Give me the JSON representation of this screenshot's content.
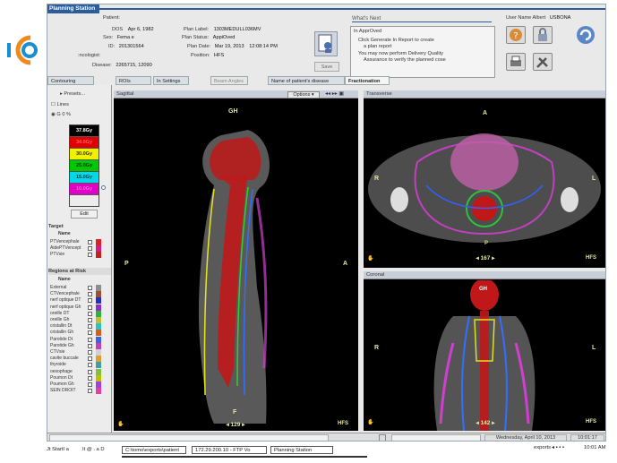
{
  "window": {
    "title": "Planning Station"
  },
  "patient": {
    "heading": "Patient:",
    "dos_label": "DOS",
    "dos": "Apr 6, 1982",
    "sex_label": "Sex:",
    "sex": "Fema e",
    "id_label": "ID:",
    "id": "201301564",
    "oncologist": ":ncologist:",
    "disease_label": "Disease:",
    "disease": "2265715, 12090"
  },
  "plan": {
    "label_label": "Plan Label:",
    "label": "1303MEDULL036MV",
    "status_label": "Plan Status:",
    "status": "AppiOved",
    "date_label": "Plan Date:",
    "date": "Mar 19, 2013",
    "time": "12:08:14 PM",
    "position_label": "Position:",
    "position": "HFS"
  },
  "save_label": "Save",
  "whats_next": {
    "title": "What's Next",
    "lines": [
      "In ApprOved",
      "Click Generate  In Report  to create",
      "a plan report",
      "You may now perform  Delivery Quality",
      "Assurance to verify the planned  cose"
    ]
  },
  "user": {
    "label": "User Name Albert",
    "name": "USBONA"
  },
  "tabs": {
    "contouring": "Contouring",
    "rois": "ROIs",
    "settings": "In Settings",
    "beam_angles": "Beam Angles",
    "name_of_disease": "Name of patient's disease",
    "fractionation": "Fractionation"
  },
  "left": {
    "presets": "Presets...",
    "lines": "Lines",
    "percent": "0  %",
    "doses": [
      "37.8Gy",
      "34.0Gy",
      "30.0Gy",
      "25.0Gy",
      "15.0Gy",
      "10.0Gy"
    ],
    "dose_colors": [
      "#000000",
      "#e00000",
      "#f0f000",
      "#00c800",
      "#00d8e8",
      "#e000c8"
    ],
    "dose_text_colors": [
      "#ffffff",
      "#ff6060",
      "#333300",
      "#003300",
      "#003340",
      "#ff60e0"
    ],
    "edit": "Edit",
    "targets_header": "Target",
    "name_header": "Name",
    "targets": [
      "PTVencephale",
      "AidePTVencept",
      "PTVsie"
    ],
    "target_colors": [
      "#e02020",
      "#d02080",
      "#c02020"
    ],
    "regions_header": "Regions  at Risk",
    "regions": [
      "External",
      "CTVencephale",
      "nerf optique DT",
      "nerf optique Gh",
      "oreille  DT",
      "oreille  Gh",
      "cristallin  Dt",
      "cristallin  Gh",
      "Parotide  Dt",
      "Parotide  Gh",
      "CTVsie",
      "cavite  buccale",
      "thyroide",
      "oesophage",
      "Poumon  Dt",
      "Poumon  Gh",
      "SEIN  DROIT"
    ],
    "region_colors": [
      "#8d8d8d",
      "#a05030",
      "#2030c0",
      "#9030c0",
      "#30b040",
      "#c0c030",
      "#30c0c0",
      "#d06020",
      "#4060e0",
      "#c040c0",
      "#d0d0d0",
      "#e0a030",
      "#40a0a0",
      "#80c040",
      "#c0c000",
      "#a040e0",
      "#e040a0"
    ]
  },
  "views": {
    "sagittal": {
      "title": "Sagittal",
      "top": "GH",
      "bottom": "F",
      "left": "P",
      "right": "A",
      "corner": "HFS",
      "slice": "129",
      "options": "Options"
    },
    "transverse": {
      "title": "Transverse",
      "top": "A",
      "bottom": "P",
      "left": "R",
      "right": "L",
      "corner": "HFS",
      "slice": "167"
    },
    "coronal": {
      "title": "Coronal",
      "top": "GH",
      "left": "R",
      "right": "L",
      "corner": "HFS",
      "slice": "142"
    }
  },
  "status": {
    "date": "Wednesday, April 10, 2013",
    "time": "10:01:17"
  },
  "taskbar": {
    "start": "Jt StartI a",
    "items": [
      "It @ . a D",
      "C:\\tomo\\exports\\patient",
      "172.29.200.10 - FTP Vo",
      "Planning Station"
    ],
    "tray_label": "exports",
    "tray_time": "10:01 AM"
  }
}
